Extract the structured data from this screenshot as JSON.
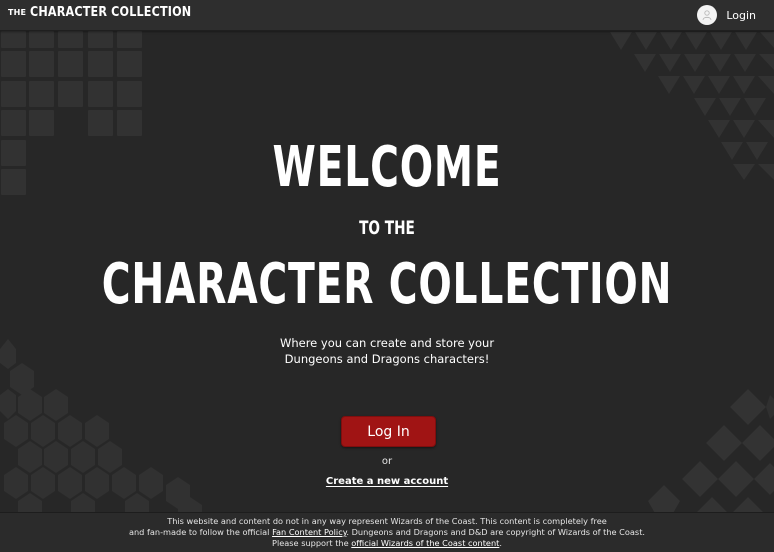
{
  "header": {
    "brand_small": "THE",
    "brand_big": "CHARACTER COLLECTION",
    "login_label": "Login",
    "avatar_icon": "user-icon"
  },
  "hero": {
    "welcome": "WELCOME",
    "to_the": "TO THE",
    "collection": "CHARACTER COLLECTION",
    "subtitle_line1": "Where you can create and store your",
    "subtitle_line2": "Dungeons and Dragons characters!",
    "login_button": "Log In",
    "or_text": "or",
    "create_account": "Create a new account"
  },
  "footer": {
    "line1": "This website and content do not in any way represent Wizards of the Coast. This content is completely free",
    "line2_pre": "and fan-made to follow the official ",
    "line2_link": "Fan Content Policy",
    "line2_post": ". Dungeons and Dragons and D&D are copyright of Wizards of the Coast.",
    "line3_pre": "Please support the ",
    "line3_link": "official Wizards of the Coast content",
    "line3_post": "."
  },
  "colors": {
    "background": "#272727",
    "header": "#2e2e2e",
    "accent": "#a01414",
    "pattern": "#333333"
  }
}
